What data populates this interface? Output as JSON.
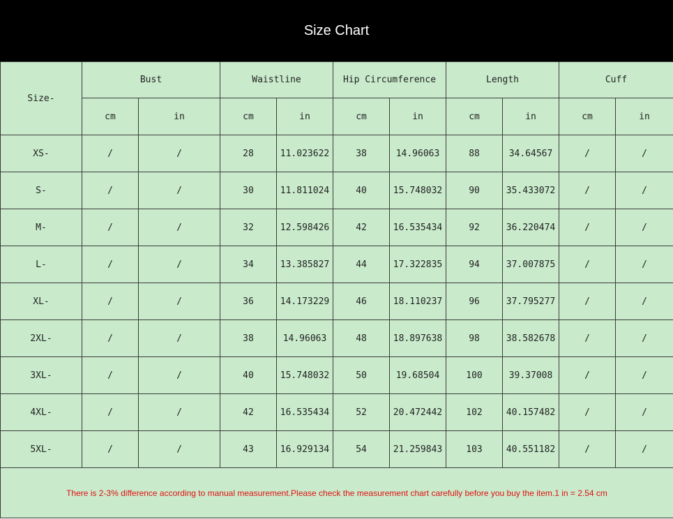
{
  "title": "Size Chart",
  "size_header": "Size-",
  "groups": [
    "Bust",
    "Waistline",
    "Hip Circumference",
    "Length",
    "Cuff"
  ],
  "units": [
    "cm",
    "in",
    "cm",
    "in",
    "cm",
    "in",
    "cm",
    "in",
    "cm",
    "in"
  ],
  "rows": [
    [
      "XS-",
      "/",
      "/",
      "28",
      "11.023622",
      "38",
      "14.96063",
      "88",
      "34.64567",
      "/",
      "/"
    ],
    [
      "S-",
      "/",
      "/",
      "30",
      "11.811024",
      "40",
      "15.748032",
      "90",
      "35.433072",
      "/",
      "/"
    ],
    [
      "M-",
      "/",
      "/",
      "32",
      "12.598426",
      "42",
      "16.535434",
      "92",
      "36.220474",
      "/",
      "/"
    ],
    [
      "L-",
      "/",
      "/",
      "34",
      "13.385827",
      "44",
      "17.322835",
      "94",
      "37.007875",
      "/",
      "/"
    ],
    [
      "XL-",
      "/",
      "/",
      "36",
      "14.173229",
      "46",
      "18.110237",
      "96",
      "37.795277",
      "/",
      "/"
    ],
    [
      "2XL-",
      "/",
      "/",
      "38",
      "14.96063",
      "48",
      "18.897638",
      "98",
      "38.582678",
      "/",
      "/"
    ],
    [
      "3XL-",
      "/",
      "/",
      "40",
      "15.748032",
      "50",
      "19.68504",
      "100",
      "39.37008",
      "/",
      "/"
    ],
    [
      "4XL-",
      "/",
      "/",
      "42",
      "16.535434",
      "52",
      "20.472442",
      "102",
      "40.157482",
      "/",
      "/"
    ],
    [
      "5XL-",
      "/",
      "/",
      "43",
      "16.929134",
      "54",
      "21.259843",
      "103",
      "40.551182",
      "/",
      "/"
    ]
  ],
  "note": "There is 2-3% difference according to manual measurement.Please check the measurement chart carefully before you buy the item.1 in = 2.54 cm",
  "colors": {
    "title_bg": "#000000",
    "title_text": "#ffffff",
    "table_bg": "#c9ebcc",
    "note_text": "#e01010"
  }
}
